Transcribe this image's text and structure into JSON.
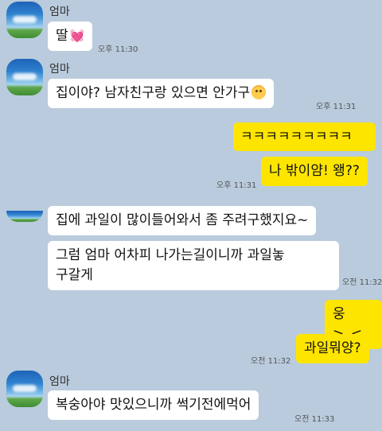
{
  "chat": {
    "sender_name": "엄마",
    "messages": [
      {
        "from": "mom",
        "text": "딸",
        "emoji": "heart-emoji",
        "time": "오후 11:30"
      },
      {
        "from": "mom",
        "text": "집이야? 남자친구랑 있으면 안가구",
        "emoji": "blushing-face-emoji",
        "time": "오후 11:31"
      },
      {
        "from": "me",
        "text": "ㅋㅋㅋㅋㅋㅋㅋㅋㅋ"
      },
      {
        "from": "me",
        "text": "나 밖이얌! 왱??",
        "time": "오후 11:31"
      },
      {
        "from": "mom",
        "text": "집에 과일이 많이들어와서 좀 주려구했지요~"
      },
      {
        "from": "mom",
        "text": "그럼 엄마 어차피 나가는길이니까 과일놓 구갈게",
        "line1": "그럼 엄마 어차피 나가는길이니까 과일놓",
        "line2": "구갈게",
        "time": "오전 11:32"
      },
      {
        "from": "me",
        "text": "웅>_<"
      },
      {
        "from": "me",
        "text": "과일뭐양?",
        "time": "오전 11:32"
      },
      {
        "from": "mom",
        "text": "복숭아야 맛있으니까 썩기전에먹어",
        "time": "오전 11:33"
      }
    ]
  },
  "colors": {
    "background": "#b9cbdc",
    "my_bubble": "#fee500",
    "their_bubble": "#ffffff"
  }
}
